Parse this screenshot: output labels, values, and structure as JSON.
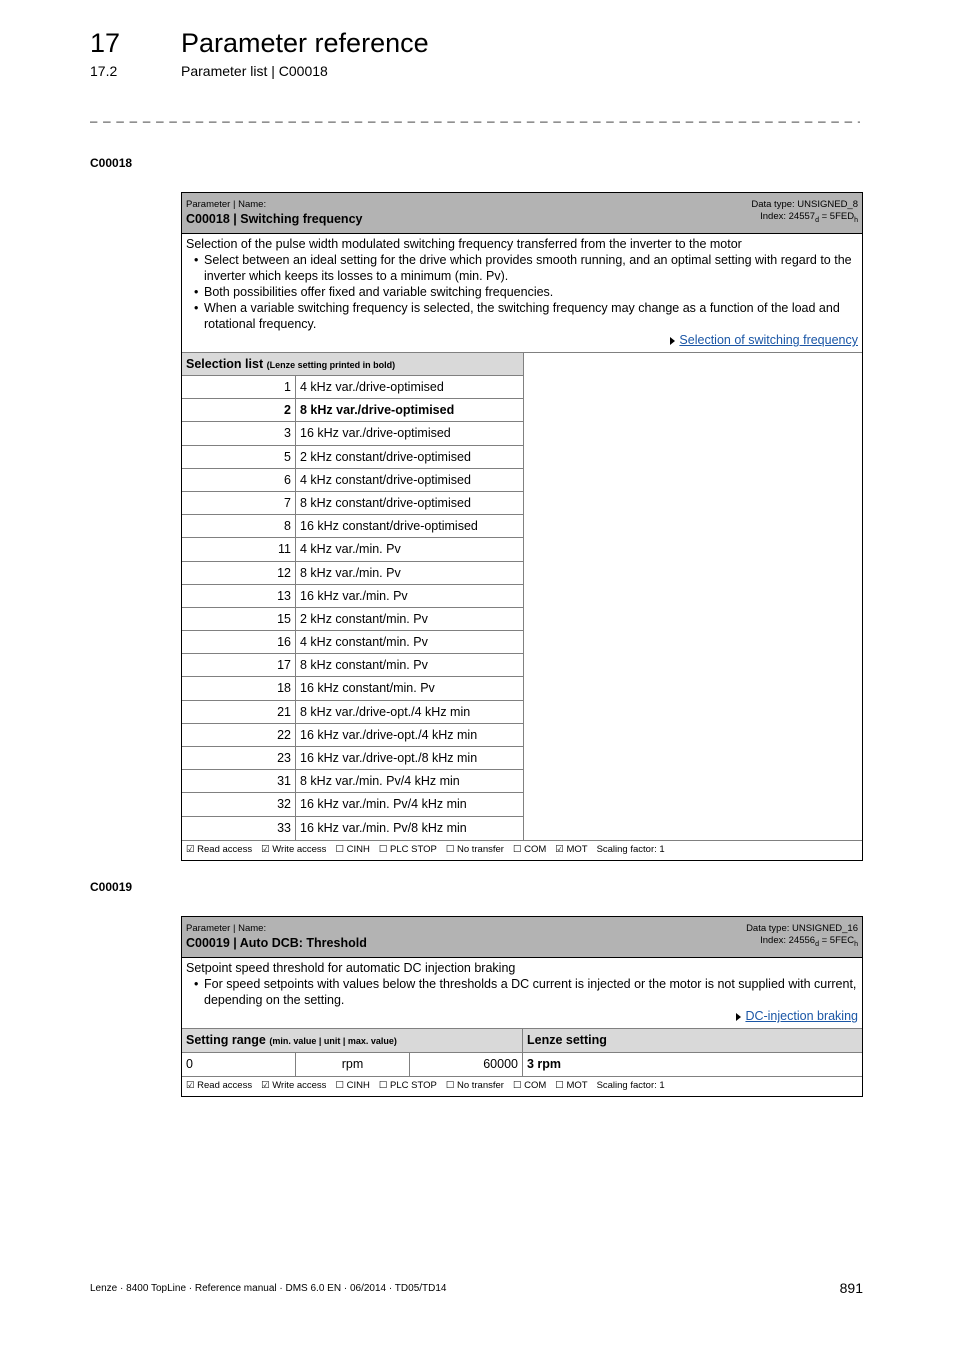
{
  "header": {
    "chapter_number": "17",
    "chapter_title": "Parameter reference",
    "section_number": "17.2",
    "section_title": "Parameter list | C00018",
    "separator": "_ _ _ _ _ _ _ _ _ _ _ _ _ _ _ _ _ _ _ _ _ _ _ _ _ _ _ _ _ _ _ _ _ _ _ _ _ _ _ _ _ _ _ _ _ _ _ _ _ _ _ _ _ _ _ _ _ _ _ _ _ _ _ _"
  },
  "params": [
    {
      "heading": "C00018",
      "label": "Parameter | Name:",
      "name": "C00018 | Switching frequency",
      "data_type": "Data type: UNSIGNED_8",
      "index_prefix": "Index: 24557",
      "index_sub_d": "d",
      "index_mid": " = 5FED",
      "index_sub_h": "h",
      "description": "Selection of the pulse width modulated switching frequency transferred from the inverter to the motor",
      "bullets": [
        "Select between an ideal setting for the drive which provides smooth running, and an optimal setting with regard to the inverter which keeps its losses to a minimum (min. Pv).",
        "Both possibilities offer fixed and variable switching frequencies.",
        "When a variable switching frequency is selected, the switching frequency may change as a function of the load and rotational frequency."
      ],
      "link": "Selection of switching frequency",
      "selection_title": "Selection list",
      "selection_note": "(Lenze setting printed in bold)",
      "selection": [
        {
          "num": "1",
          "text": "4 kHz var./drive-optimised",
          "bold": false
        },
        {
          "num": "2",
          "text": "8 kHz var./drive-optimised",
          "bold": true
        },
        {
          "num": "3",
          "text": "16 kHz var./drive-optimised",
          "bold": false
        },
        {
          "num": "5",
          "text": "2 kHz constant/drive-optimised",
          "bold": false
        },
        {
          "num": "6",
          "text": "4 kHz constant/drive-optimised",
          "bold": false
        },
        {
          "num": "7",
          "text": "8 kHz constant/drive-optimised",
          "bold": false
        },
        {
          "num": "8",
          "text": "16 kHz constant/drive-optimised",
          "bold": false
        },
        {
          "num": "11",
          "text": "4 kHz var./min. Pv",
          "bold": false
        },
        {
          "num": "12",
          "text": "8 kHz var./min. Pv",
          "bold": false
        },
        {
          "num": "13",
          "text": "16 kHz var./min. Pv",
          "bold": false
        },
        {
          "num": "15",
          "text": "2 kHz constant/min. Pv",
          "bold": false
        },
        {
          "num": "16",
          "text": "4 kHz constant/min. Pv",
          "bold": false
        },
        {
          "num": "17",
          "text": "8 kHz constant/min. Pv",
          "bold": false
        },
        {
          "num": "18",
          "text": "16 kHz constant/min. Pv",
          "bold": false
        },
        {
          "num": "21",
          "text": "8 kHz var./drive-opt./4 kHz min",
          "bold": false
        },
        {
          "num": "22",
          "text": "16 kHz var./drive-opt./4 kHz min",
          "bold": false
        },
        {
          "num": "23",
          "text": "16 kHz var./drive-opt./8 kHz min",
          "bold": false
        },
        {
          "num": "31",
          "text": "8 kHz var./min. Pv/4 kHz min",
          "bold": false
        },
        {
          "num": "32",
          "text": "16 kHz var./min. Pv/4 kHz min",
          "bold": false
        },
        {
          "num": "33",
          "text": "16 kHz var./min. Pv/8 kHz min",
          "bold": false
        }
      ],
      "flags": [
        "☑ Read access",
        "☑ Write access",
        "☐ CINH",
        "☐ PLC STOP",
        "☐ No transfer",
        "☐ COM",
        "☑ MOT",
        "Scaling factor: 1"
      ]
    },
    {
      "heading": "C00019",
      "label": "Parameter | Name:",
      "name": "C00019 | Auto DCB: Threshold",
      "data_type": "Data type: UNSIGNED_16",
      "index_prefix": "Index: 24556",
      "index_sub_d": "d",
      "index_mid": " = 5FEC",
      "index_sub_h": "h",
      "description": "Setpoint speed  threshold for automatic DC injection braking",
      "bullets": [
        "For speed setpoints with values below the thresholds a DC current is injected or the motor is not supplied with current, depending on the setting."
      ],
      "link": "DC-injection braking",
      "range_title": "Setting range",
      "range_note": "(min. value | unit | max. value)",
      "lenze_title": "Lenze setting",
      "range_min": "0",
      "range_unit": "rpm",
      "range_max": "60000",
      "lenze_value": "3 rpm",
      "flags": [
        "☑ Read access",
        "☑ Write access",
        "☐ CINH",
        "☐ PLC STOP",
        "☐ No transfer",
        "☐ COM",
        "☐ MOT",
        "Scaling factor: 1"
      ]
    }
  ],
  "footer": {
    "text": "Lenze · 8400 TopLine · Reference manual · DMS 6.0 EN · 06/2014 · TD05/TD14",
    "page_number": "891"
  },
  "colors": {
    "header_bar": "#b3b3b3",
    "subheader": "#d9d9d9",
    "link": "#1a56a6"
  }
}
